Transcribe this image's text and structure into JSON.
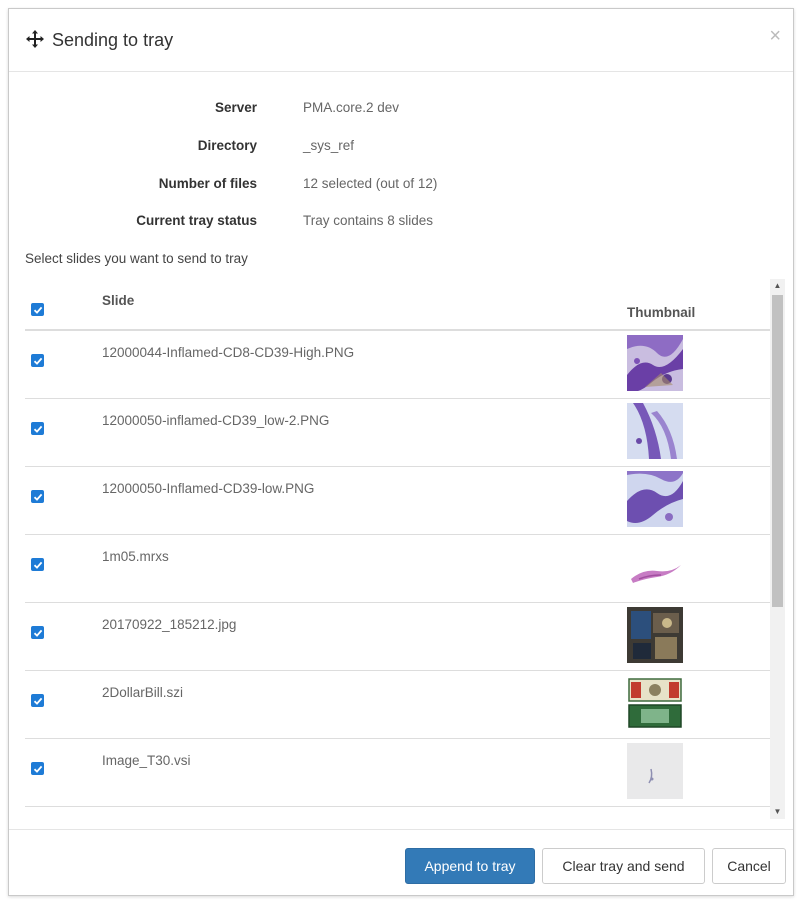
{
  "dialog": {
    "title": "Sending to tray",
    "close_symbol": "×"
  },
  "info": [
    {
      "label": "Server",
      "value": "PMA.core.2 dev"
    },
    {
      "label": "Directory",
      "value": "_sys_ref"
    },
    {
      "label": "Number of files",
      "value": "12 selected (out of 12)"
    },
    {
      "label": "Current tray status",
      "value": "Tray contains 8 slides"
    }
  ],
  "instruction": "Select slides you want to send to tray",
  "table": {
    "header_slide": "Slide",
    "header_thumbnail": "Thumbnail",
    "rows": [
      {
        "name": "12000044-Inflamed-CD8-CD39-High.PNG",
        "checked": true
      },
      {
        "name": "12000050-inflamed-CD39_low-2.PNG",
        "checked": true
      },
      {
        "name": "12000050-Inflamed-CD39-low.PNG",
        "checked": true
      },
      {
        "name": "1m05.mrxs",
        "checked": true
      },
      {
        "name": "20170922_185212.jpg",
        "checked": true
      },
      {
        "name": "2DollarBill.szi",
        "checked": true
      },
      {
        "name": "Image_T30.vsi",
        "checked": true
      }
    ]
  },
  "footer": {
    "append_label": "Append to tray",
    "clear_send_label": "Clear tray and send",
    "cancel_label": "Cancel"
  },
  "icons": {
    "move": "move-icon",
    "close": "close-icon",
    "checkbox": "checkmark-icon",
    "scroll_up": "arrow-up-icon",
    "scroll_down": "arrow-down-icon"
  },
  "colors": {
    "primary": "#337ab7",
    "checkbox": "#1e7bd6"
  }
}
